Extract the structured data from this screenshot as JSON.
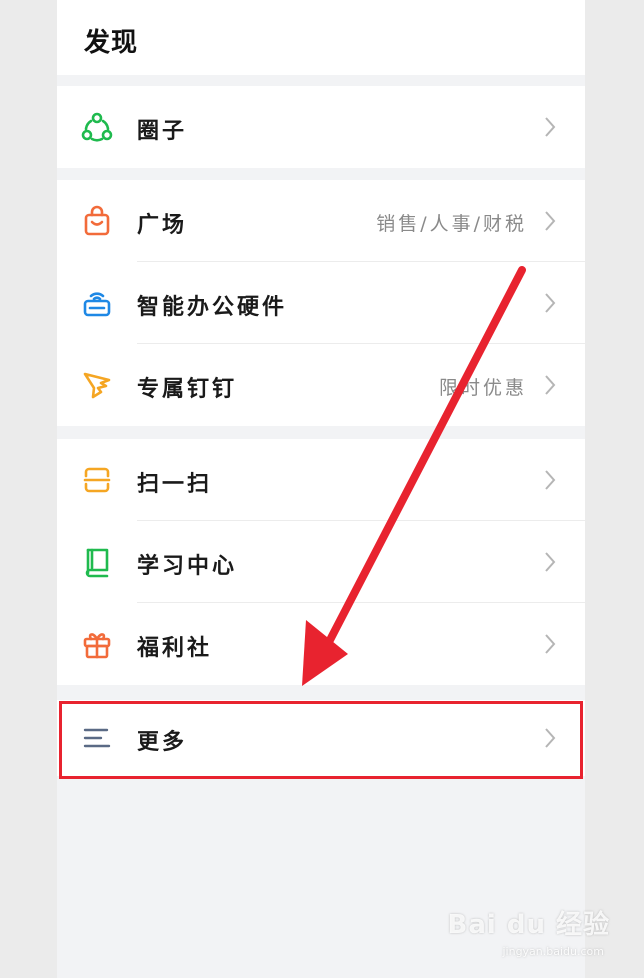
{
  "header": {
    "title": "发现"
  },
  "groups": [
    {
      "items": [
        {
          "label": "圈子",
          "sub": ""
        }
      ]
    },
    {
      "items": [
        {
          "label": "广场",
          "sub": "销售/人事/财税"
        },
        {
          "label": "智能办公硬件",
          "sub": ""
        },
        {
          "label": "专属钉钉",
          "sub": "限时优惠"
        }
      ]
    },
    {
      "items": [
        {
          "label": "扫一扫",
          "sub": ""
        },
        {
          "label": "学习中心",
          "sub": ""
        },
        {
          "label": "福利社",
          "sub": ""
        }
      ]
    },
    {
      "items": [
        {
          "label": "更多",
          "sub": ""
        }
      ]
    }
  ],
  "icons": {
    "circle": "circle-network-icon",
    "plaza": "shopping-bag-icon",
    "hardware": "smart-hardware-icon",
    "exclusive": "wing-icon",
    "scan": "scan-icon",
    "learning": "book-icon",
    "welfare": "gift-icon",
    "more": "menu-lines-icon"
  },
  "colors": {
    "green": "#1fba4e",
    "orange": "#f26b3a",
    "blue": "#1e88e5",
    "amber": "#f5a623",
    "gray_icon": "#5a6a85",
    "highlight_red": "#e8232f"
  },
  "watermark": {
    "brand": "Bai du 经验",
    "url": "jingyan.baidu.com"
  }
}
